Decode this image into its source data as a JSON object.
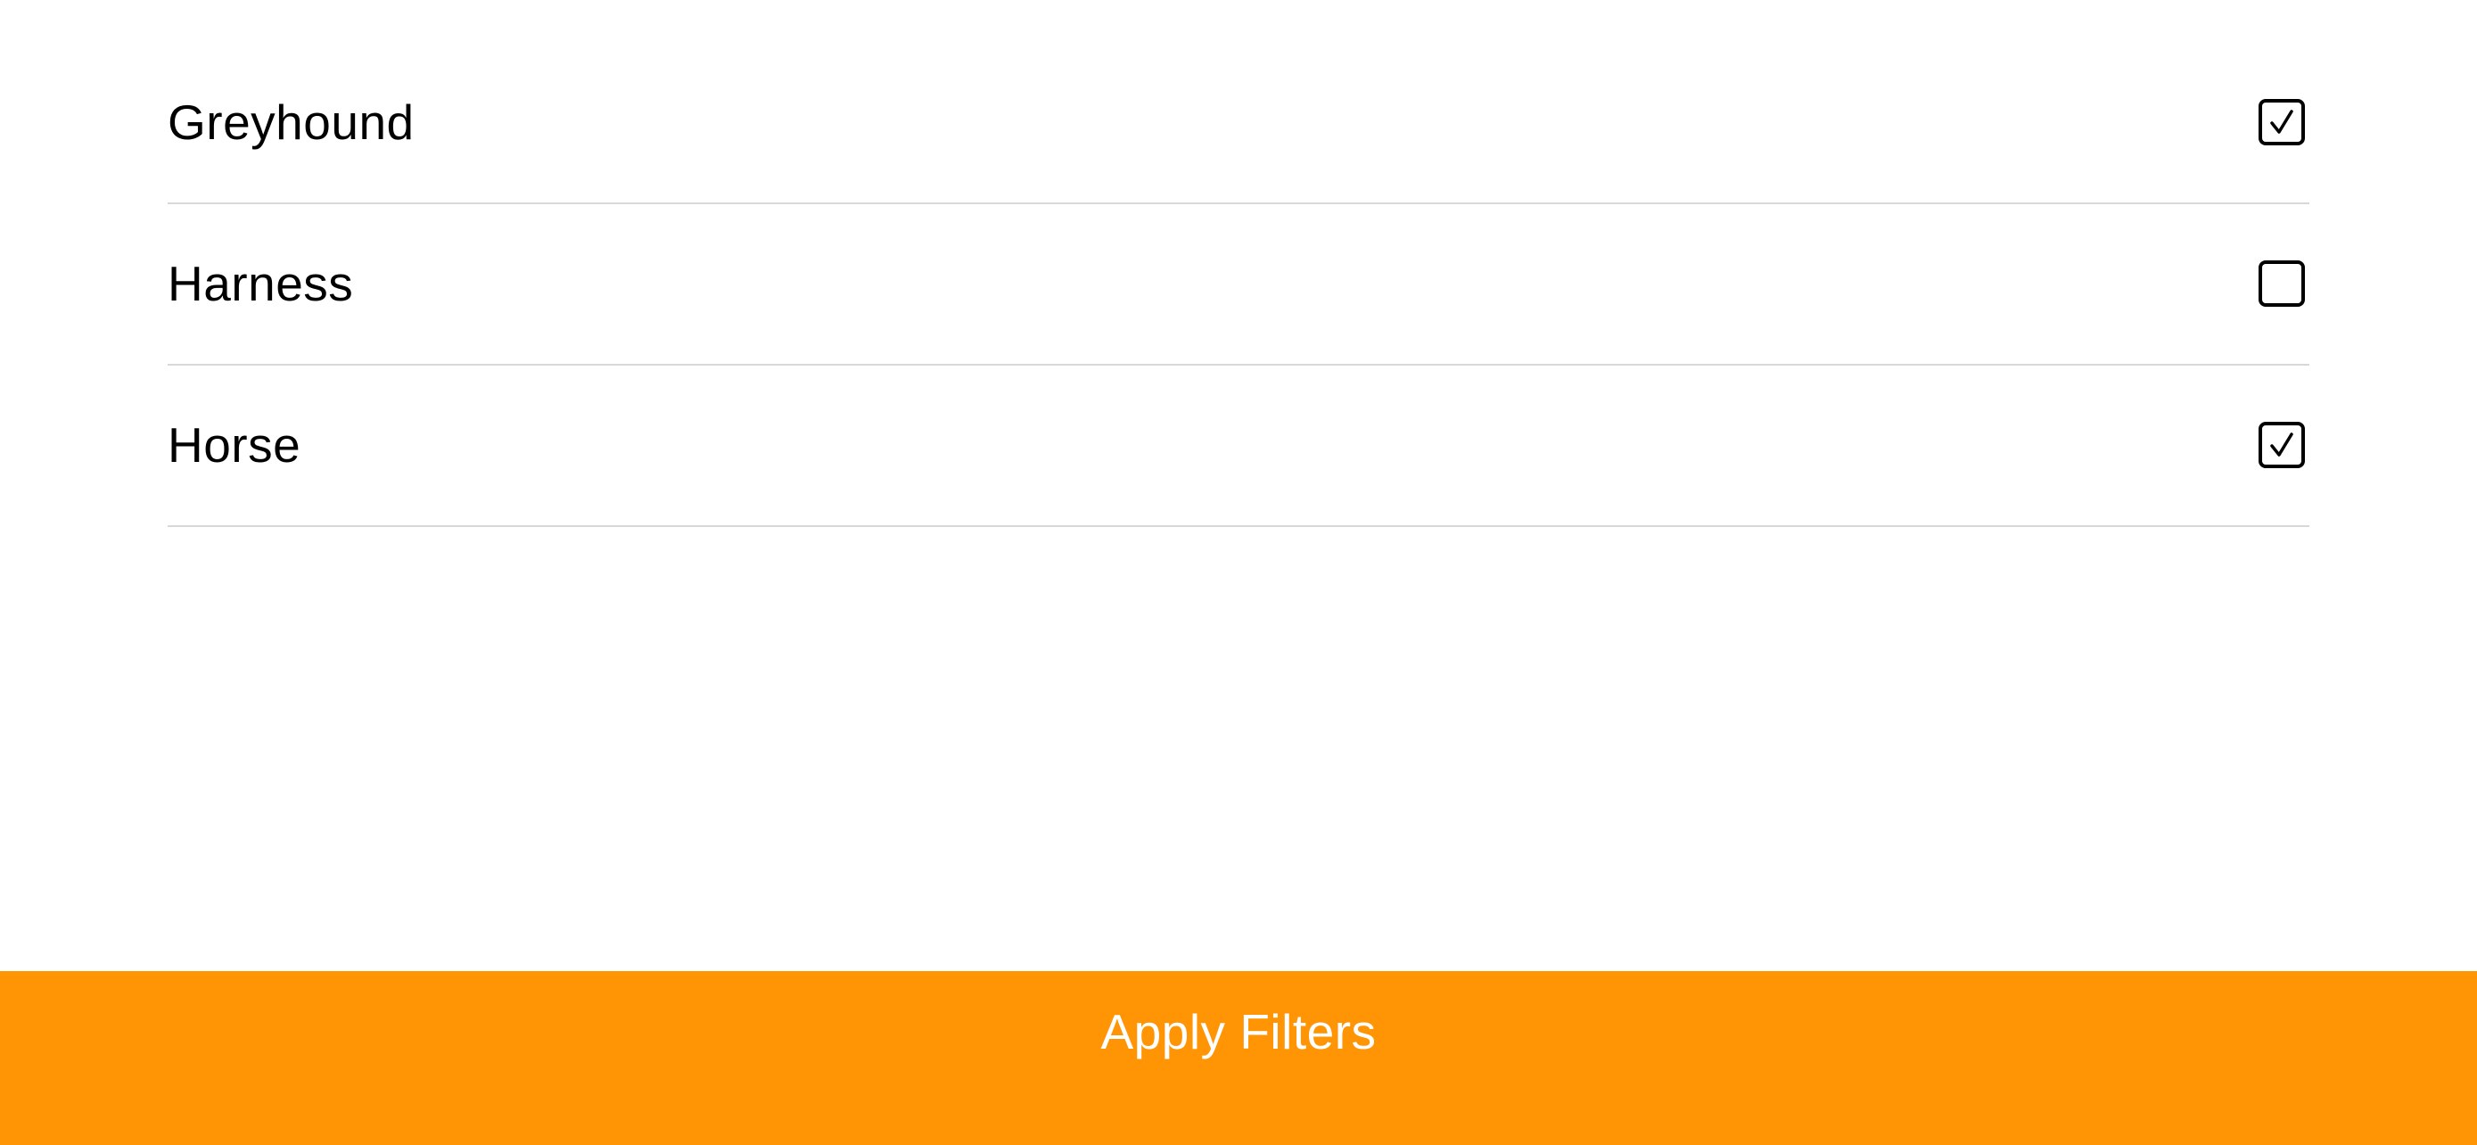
{
  "filters": {
    "items": [
      {
        "label": "Greyhound",
        "checked": true
      },
      {
        "label": "Harness",
        "checked": false
      },
      {
        "label": "Horse",
        "checked": true
      }
    ]
  },
  "apply_button": {
    "label": "Apply Filters",
    "background_color": "#ff9505",
    "text_color": "#ffffff"
  },
  "icons": {
    "checked": "checkbox-checked-icon",
    "unchecked": "checkbox-unchecked-icon"
  }
}
